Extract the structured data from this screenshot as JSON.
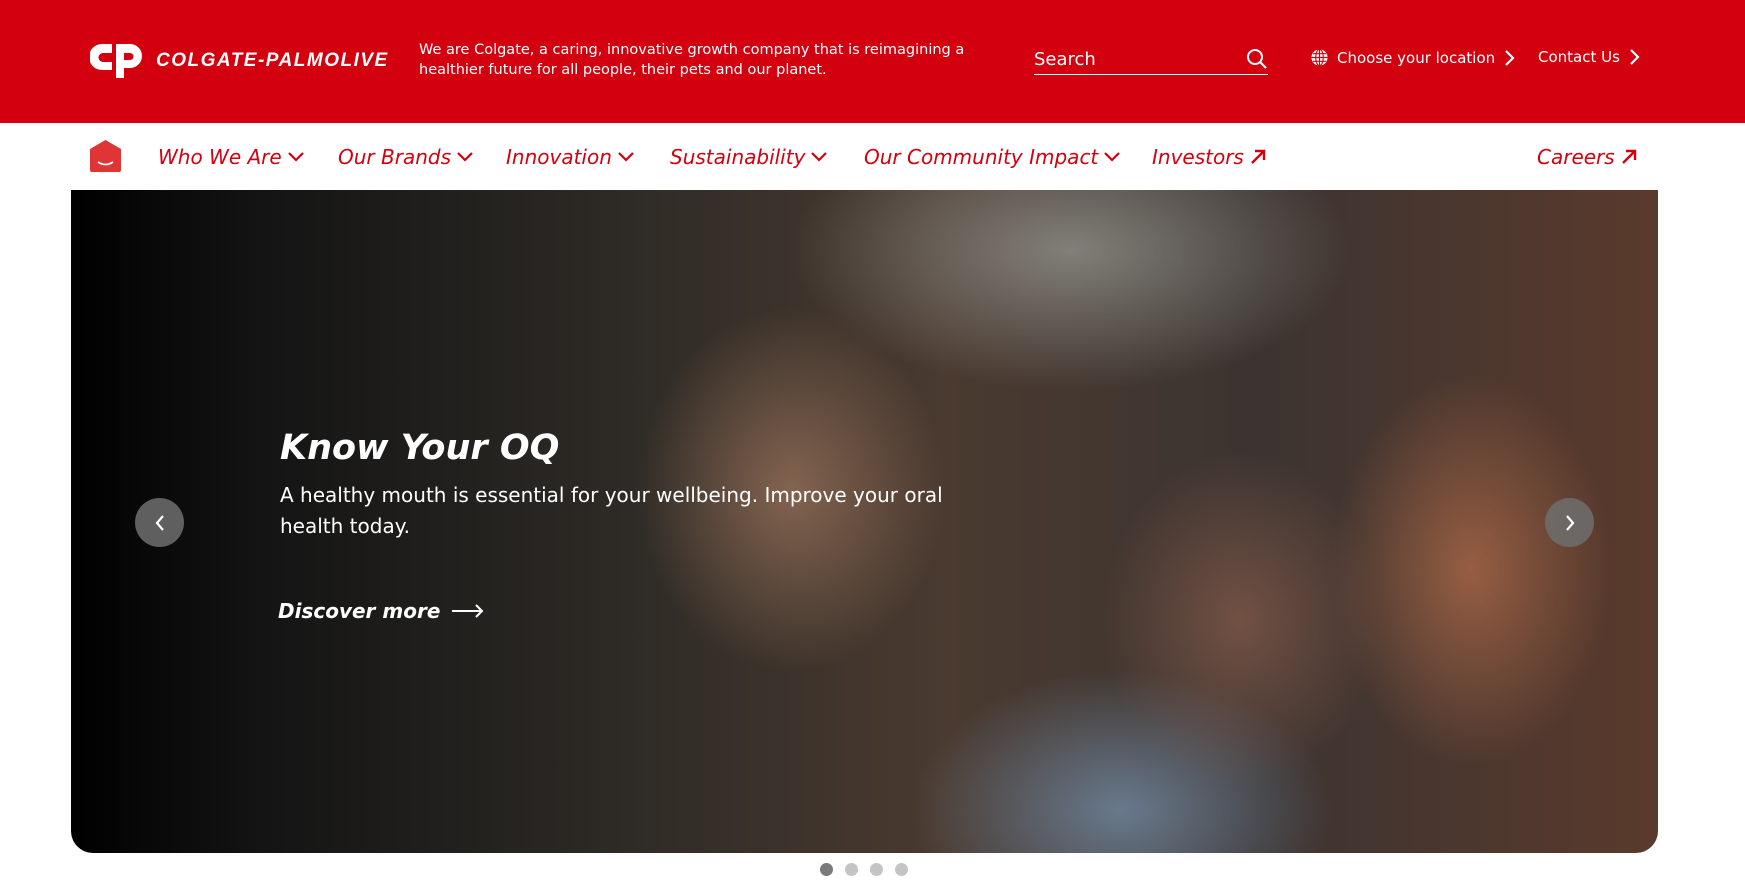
{
  "header": {
    "brand": "COLGATE-PALMOLIVE",
    "tagline": "We are Colgate, a caring, innovative growth company that is reimagining a healthier future for all people, their pets and our planet.",
    "search_placeholder": "Search",
    "location_label": "Choose your location",
    "contact_label": "Contact Us",
    "brand_color": "#d3000f"
  },
  "nav": {
    "items": [
      {
        "label": "Who We Are",
        "icon": "chevron-down"
      },
      {
        "label": "Our Brands",
        "icon": "chevron-down"
      },
      {
        "label": "Innovation",
        "icon": "chevron-down"
      },
      {
        "label": "Sustainability",
        "icon": "chevron-down"
      },
      {
        "label": "Our Community Impact",
        "icon": "chevron-down"
      },
      {
        "label": "Investors",
        "icon": "arrow-up-right"
      }
    ],
    "careers": "Careers"
  },
  "hero": {
    "title": "Know Your OQ",
    "subtitle": "A healthy mouth is essential for your wellbeing. Improve your oral health today.",
    "cta": "Discover more",
    "slides": 4,
    "active_slide": 1
  }
}
